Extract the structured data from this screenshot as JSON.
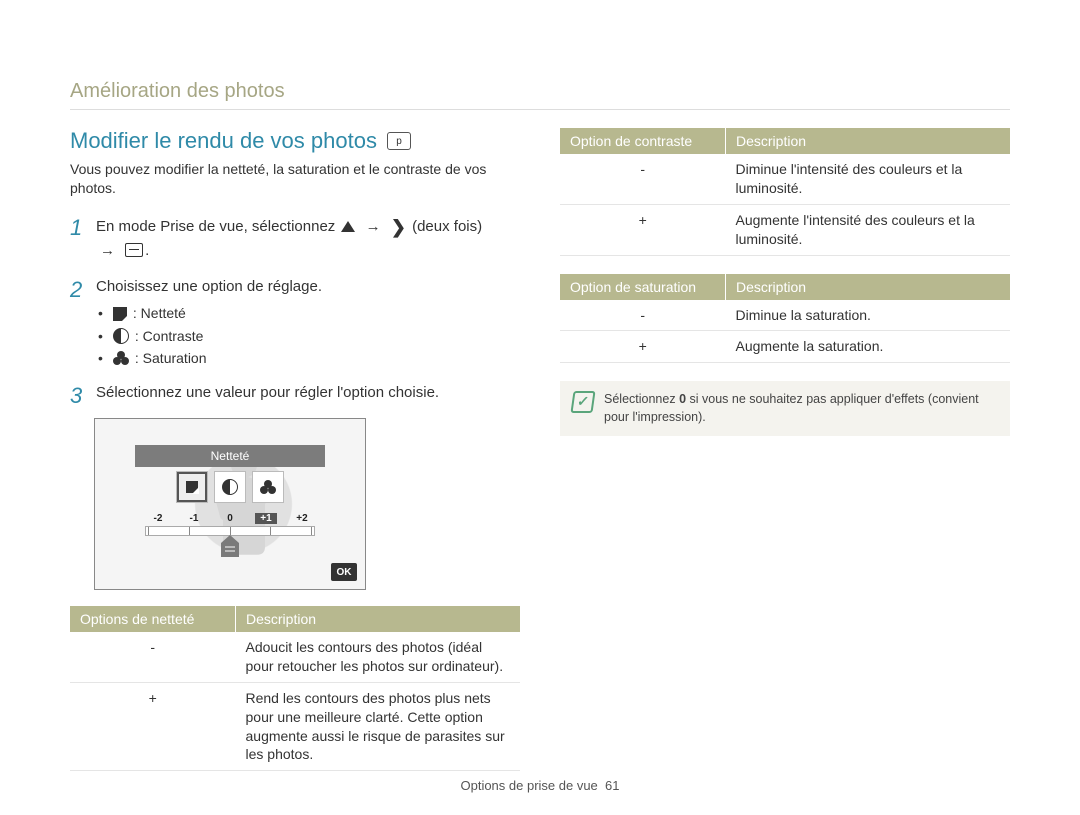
{
  "section_title": "Amélioration des photos",
  "heading": "Modifier le rendu de vos photos",
  "mode_icon_label": "p",
  "intro": "Vous pouvez modifier la netteté, la saturation et le contraste de vos photos.",
  "steps": {
    "s1": {
      "num": "1",
      "pre": "En mode Prise de vue, sélectionnez ",
      "arrow": "→",
      "twice": " (deux fois) ",
      "post": "."
    },
    "s2": {
      "num": "2",
      "text": "Choisissez une option de réglage.",
      "bullets": {
        "sharp": ": Netteté",
        "contrast": ": Contraste",
        "sat": ": Saturation"
      }
    },
    "s3": {
      "num": "3",
      "text": "Sélectionnez une valeur pour régler l'option choisie."
    }
  },
  "lcd": {
    "title": "Netteté",
    "scale": [
      "-2",
      "-1",
      "0",
      "+1",
      "+2"
    ],
    "ok": "OK"
  },
  "tables": {
    "sharpness": {
      "h1": "Options de netteté",
      "h2": "Description",
      "rows": [
        {
          "opt": "-",
          "desc": "Adoucit les contours des photos (idéal pour retoucher les photos sur ordinateur)."
        },
        {
          "opt": "+",
          "desc": "Rend les contours des photos plus nets pour une meilleure clarté. Cette option augmente aussi le risque de parasites sur les photos."
        }
      ]
    },
    "contrast": {
      "h1": "Option de contraste",
      "h2": "Description",
      "rows": [
        {
          "opt": "-",
          "desc": "Diminue l'intensité des couleurs et la luminosité."
        },
        {
          "opt": "+",
          "desc": "Augmente l'intensité des couleurs et la luminosité."
        }
      ]
    },
    "saturation": {
      "h1": "Option de saturation",
      "h2": "Description",
      "rows": [
        {
          "opt": "-",
          "desc": "Diminue la saturation."
        },
        {
          "opt": "+",
          "desc": "Augmente la saturation."
        }
      ]
    }
  },
  "note": {
    "pre": "Sélectionnez ",
    "bold": "0",
    "post": " si vous ne souhaitez pas appliquer d'effets (convient pour l'impression)."
  },
  "footer": {
    "label": "Options de prise de vue",
    "page": "61"
  }
}
